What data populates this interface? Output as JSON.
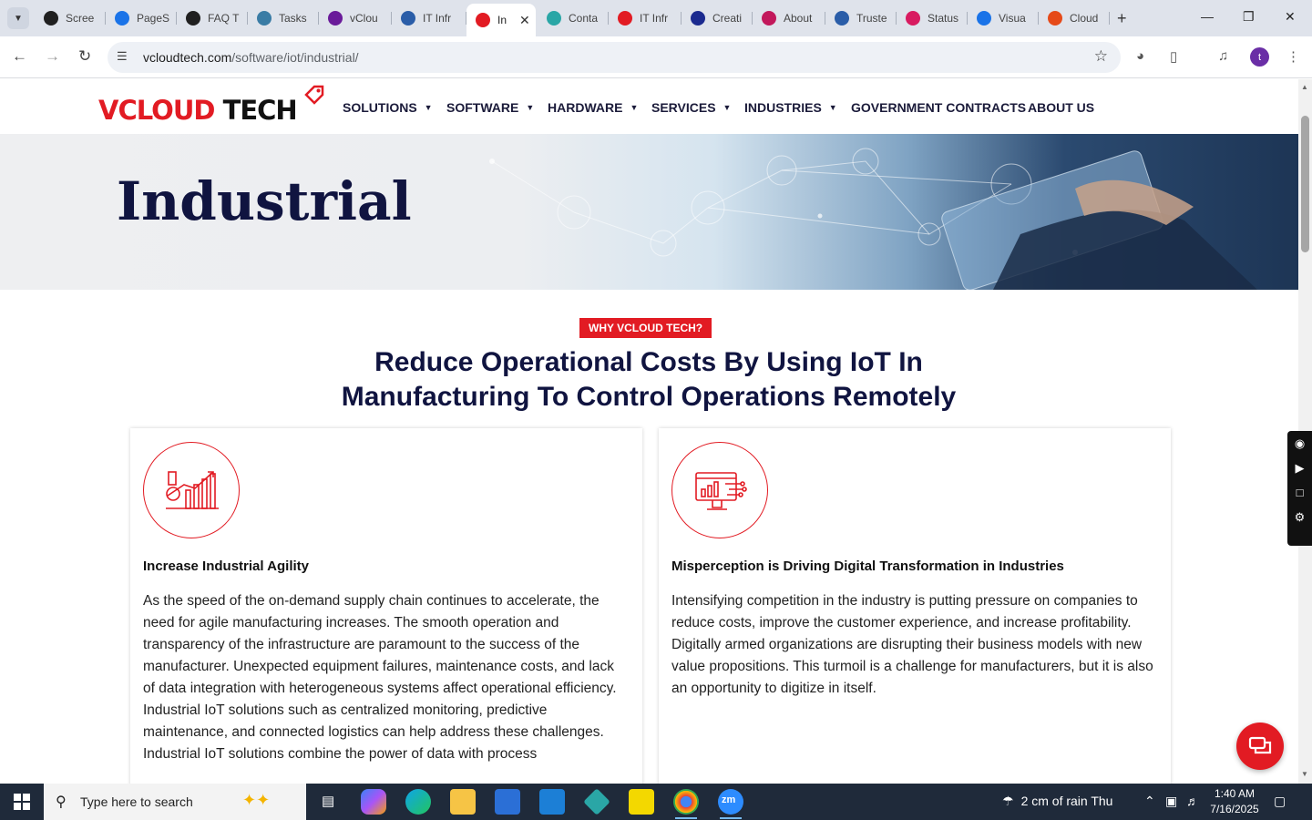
{
  "browser": {
    "tabs": [
      {
        "label": "Scree",
        "color": "#202020"
      },
      {
        "label": "PageS",
        "color": "#1a73e8"
      },
      {
        "label": "FAQ T",
        "color": "#202020"
      },
      {
        "label": "Tasks",
        "color": "#3a7ca5"
      },
      {
        "label": "vClou",
        "color": "#6a1b9a"
      },
      {
        "label": "IT Infr",
        "color": "#2a5da8"
      },
      {
        "label": "In",
        "color": "#e21b23"
      },
      {
        "label": "Conta",
        "color": "#2aa6a6"
      },
      {
        "label": "IT Infr",
        "color": "#e21b23"
      },
      {
        "label": "Creati",
        "color": "#1b2a8f"
      },
      {
        "label": "About",
        "color": "#c2185b"
      },
      {
        "label": "Truste",
        "color": "#2a5da8"
      },
      {
        "label": "Status",
        "color": "#d81b60"
      },
      {
        "label": "Visua",
        "color": "#1a73e8"
      },
      {
        "label": "Cloud",
        "color": "#e64a19"
      }
    ],
    "url_host": "vcloudtech.com",
    "url_path": "/software/iot/industrial/",
    "profile_initial": "t"
  },
  "site": {
    "logo_red": "VCLOUD",
    "logo_dark": "TECH",
    "menu": [
      {
        "label": "SOLUTIONS",
        "has_caret": true
      },
      {
        "label": "SOFTWARE",
        "has_caret": true
      },
      {
        "label": "HARDWARE",
        "has_caret": true
      },
      {
        "label": "SERVICES",
        "has_caret": true
      },
      {
        "label": "INDUSTRIES",
        "has_caret": true
      },
      {
        "label": "GOVERNMENT CONTRACTS",
        "has_caret": false
      },
      {
        "label": "ABOUT US",
        "has_caret": false
      }
    ],
    "hero_title": "Industrial",
    "badge": "WHY VCLOUD TECH?",
    "section_title_1": "Reduce Operational Costs By Using IoT In",
    "section_title_2": "Manufacturing To Control Operations Remotely",
    "cards": [
      {
        "icon": "factory-growth-icon",
        "title": "Increase Industrial Agility",
        "text": "As the speed of the on-demand supply chain continues to accelerate, the need for agile manufacturing increases. The smooth operation and transparency of the infrastructure are paramount to the success of the manufacturer. Unexpected equipment failures, maintenance costs, and lack of data integration with heterogeneous systems affect operational efficiency. Industrial IoT solutions such as centralized monitoring, predictive maintenance, and connected logistics can help address these challenges. Industrial IoT solutions combine the power of data with process"
      },
      {
        "icon": "digital-monitor-icon",
        "title": "Misperception is Driving Digital Transformation in Industries",
        "text": "Intensifying competition in the industry is putting pressure on companies to reduce costs, improve the customer experience, and increase profitability. Digitally armed organizations are disrupting their business models with new value propositions. This turmoil is a challenge for manufacturers, but it is also an opportunity to digitize in itself."
      }
    ],
    "accent_color": "#e21b23",
    "heading_color": "#101440"
  },
  "taskbar": {
    "search_placeholder": "Type here to search",
    "weather": "2 cm of rain Thu",
    "time": "1:40 AM",
    "date": "7/16/2025"
  }
}
